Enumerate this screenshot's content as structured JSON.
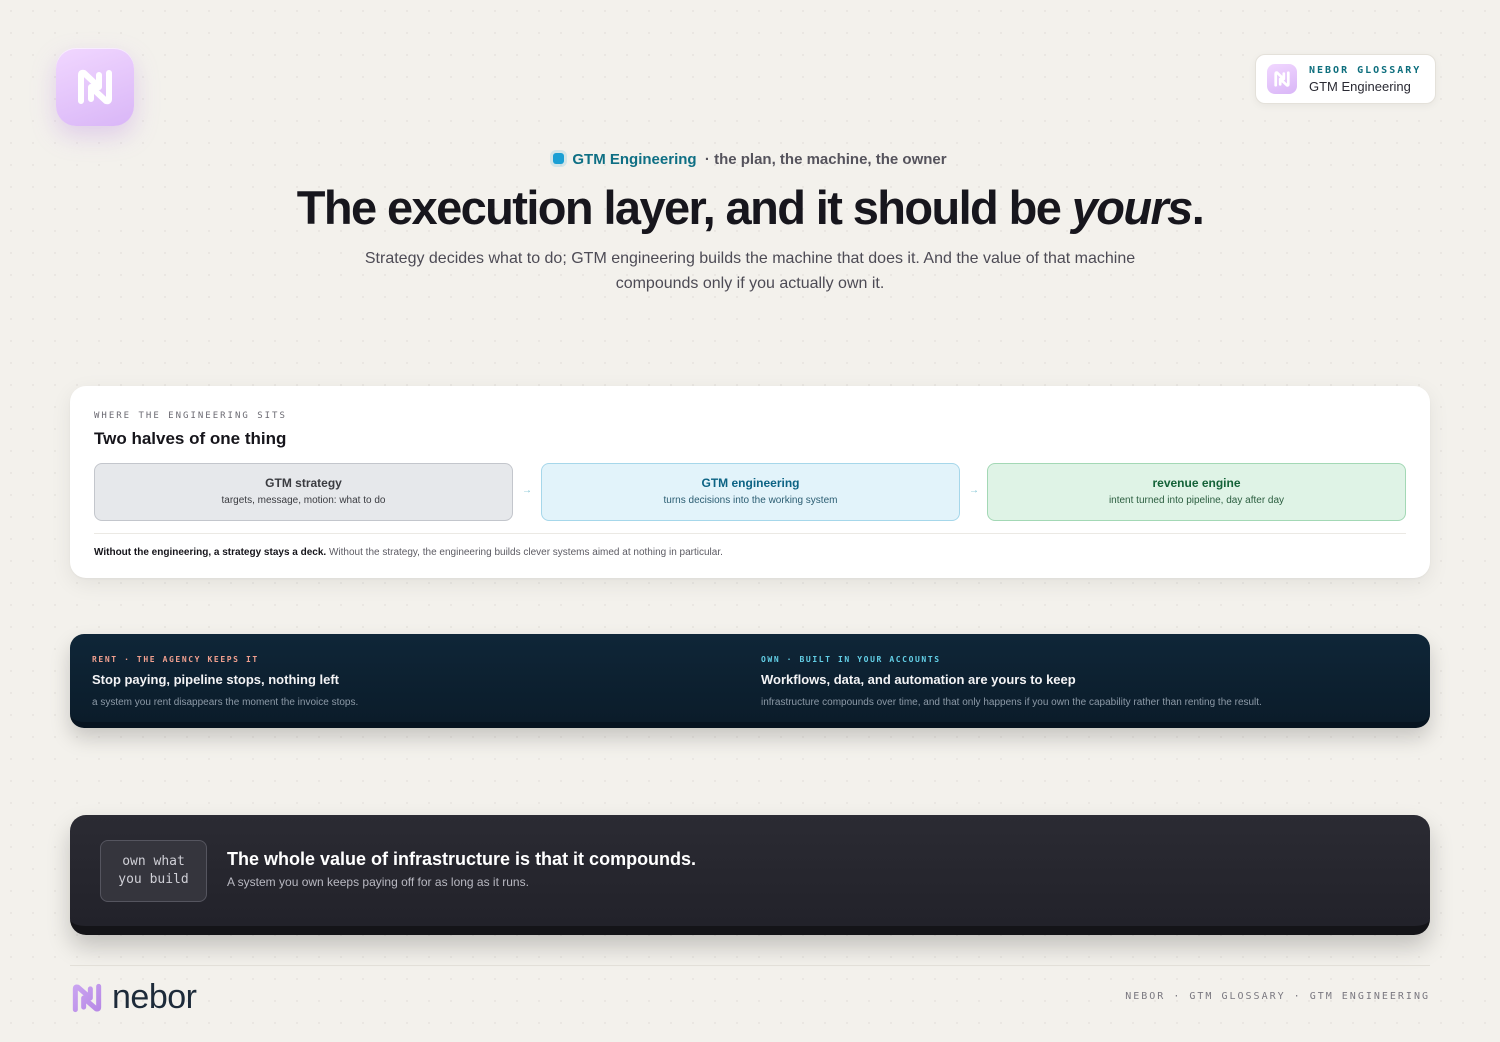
{
  "brand": {
    "logo_text": "nebor",
    "badge_kicker": "NEBOR GLOSSARY",
    "badge_title": "GTM Engineering",
    "accent_color": "#0e6f84",
    "brand_purple": "#d9b6f7"
  },
  "hero": {
    "eyebrow_label": "GTM Engineering",
    "eyebrow_rest": "· the plan, the machine, the owner",
    "headline_main": "The execution layer, and it should be ",
    "headline_em": "yours",
    "headline_end": ".",
    "subhead": "Strategy decides what to do; GTM engineering builds the machine that does it. And the value of that machine compounds only if you actually own it."
  },
  "card": {
    "kicker": "WHERE THE ENGINEERING SITS",
    "title": "Two halves of one thing",
    "stages": [
      {
        "title": "GTM strategy",
        "sub": "targets, message, motion: what to do"
      },
      {
        "title": "GTM engineering",
        "sub": "turns decisions into the working system"
      },
      {
        "title": "revenue engine",
        "sub": "intent turned into pipeline, day after day"
      }
    ],
    "arrow": "→",
    "note_bold": "Without the engineering, a strategy stays a deck.",
    "note_rest": " Without the strategy, the engineering builds clever systems aimed at nothing in particular."
  },
  "compare": {
    "rent": {
      "kicker": "RENT · THE AGENCY KEEPS IT",
      "title": "Stop paying, pipeline stops, nothing left",
      "sub": "a system you rent disappears the moment the invoice stops."
    },
    "own": {
      "kicker": "OWN · BUILT IN YOUR ACCOUNTS",
      "title": "Workflows, data, and automation are yours to keep",
      "sub": "infrastructure compounds over time, and that only happens if you own the capability rather than renting the result."
    }
  },
  "callout": {
    "chip_line1": "own what",
    "chip_line2": "you build",
    "title": "The whole value of infrastructure is that it compounds.",
    "sub": "A system you own keeps paying off for as long as it runs."
  },
  "footer": {
    "meta": "NEBOR · GTM GLOSSARY · GTM ENGINEERING"
  }
}
